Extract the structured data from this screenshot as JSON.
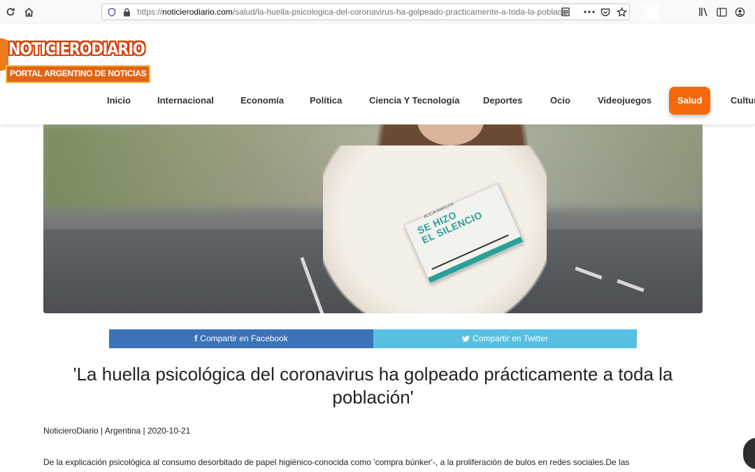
{
  "browser": {
    "url_prefix": "https://",
    "url_host": "noticierodiario.com",
    "url_path": "/salud/la-huella-psicologica-del-coronavirus-ha-golpeado-practicamente-a-toda-la-poblacio"
  },
  "logo": {
    "name": "NOTICIERODIARIO",
    "tagline": "PORTAL ARGENTINO DE NOTICIAS"
  },
  "menu": {
    "items": [
      {
        "label": "Inicio"
      },
      {
        "label": "Internacional"
      },
      {
        "label": "Economía"
      },
      {
        "label": "Política"
      },
      {
        "label": "Ciencia Y Tecnología"
      },
      {
        "label": "Deportes"
      },
      {
        "label": "Ocio"
      },
      {
        "label": "Videojuegos"
      },
      {
        "label": "Salud"
      },
      {
        "label": "Cultur"
      }
    ],
    "active": "Salud"
  },
  "hero": {
    "book_author": "ALICIA MARCOS",
    "book_title_1": "SE HIZO",
    "book_title_2": "EL SILENCIO"
  },
  "share": {
    "facebook_label": "Compartir en Facebook",
    "twitter_label": "Compartir en Twitter",
    "facebook_icon": "f",
    "colors": {
      "facebook": "#3b73b9",
      "twitter": "#57c0e2"
    }
  },
  "article": {
    "title": "'La huella psicológica del coronavirus ha golpeado prácticamente a toda la población'",
    "byline": "NoticieroDiario | Argentina | 2020-10-21",
    "lead": "De la explicación psicológica al consumo desorbitado de papel higiénico-conocida como 'compra búnker'-, a la proliferación de bulos en redes sociales.De las"
  },
  "colors": {
    "accent": "#f46a0b"
  }
}
